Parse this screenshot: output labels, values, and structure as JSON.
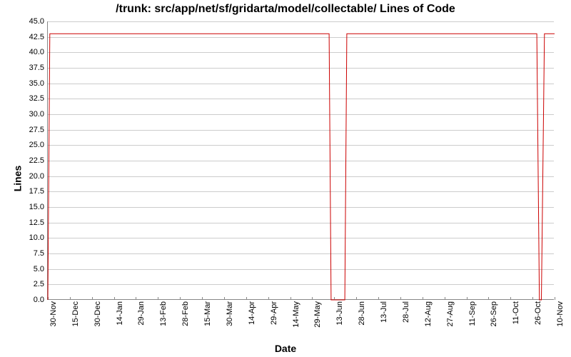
{
  "chart_data": {
    "type": "line",
    "title": "/trunk: src/app/net/sf/gridarta/model/collectable/ Lines of Code",
    "xlabel": "Date",
    "ylabel": "Lines",
    "ylim": [
      0,
      45
    ],
    "ytick_interval": 2.5,
    "yticks": [
      0.0,
      2.5,
      5.0,
      7.5,
      10.0,
      12.5,
      15.0,
      17.5,
      20.0,
      22.5,
      25.0,
      27.5,
      30.0,
      32.5,
      35.0,
      37.5,
      40.0,
      42.5,
      45.0
    ],
    "xticks": [
      "30-Nov",
      "15-Dec",
      "30-Dec",
      "14-Jan",
      "29-Jan",
      "13-Feb",
      "28-Feb",
      "15-Mar",
      "30-Mar",
      "14-Apr",
      "29-Apr",
      "14-May",
      "29-May",
      "13-Jun",
      "28-Jun",
      "13-Jul",
      "28-Jul",
      "12-Aug",
      "27-Aug",
      "11-Sep",
      "26-Sep",
      "11-Oct",
      "26-Oct",
      "10-Nov"
    ],
    "x": [
      0,
      0.4,
      55.5,
      55.9,
      58.6,
      59.0,
      96.5,
      97.0,
      97.4,
      98.0,
      100
    ],
    "series": [
      {
        "name": "Lines of Code",
        "color": "#cc0000",
        "values": [
          0,
          43,
          43,
          0,
          0,
          43,
          43,
          0,
          0,
          43,
          43
        ]
      }
    ]
  }
}
